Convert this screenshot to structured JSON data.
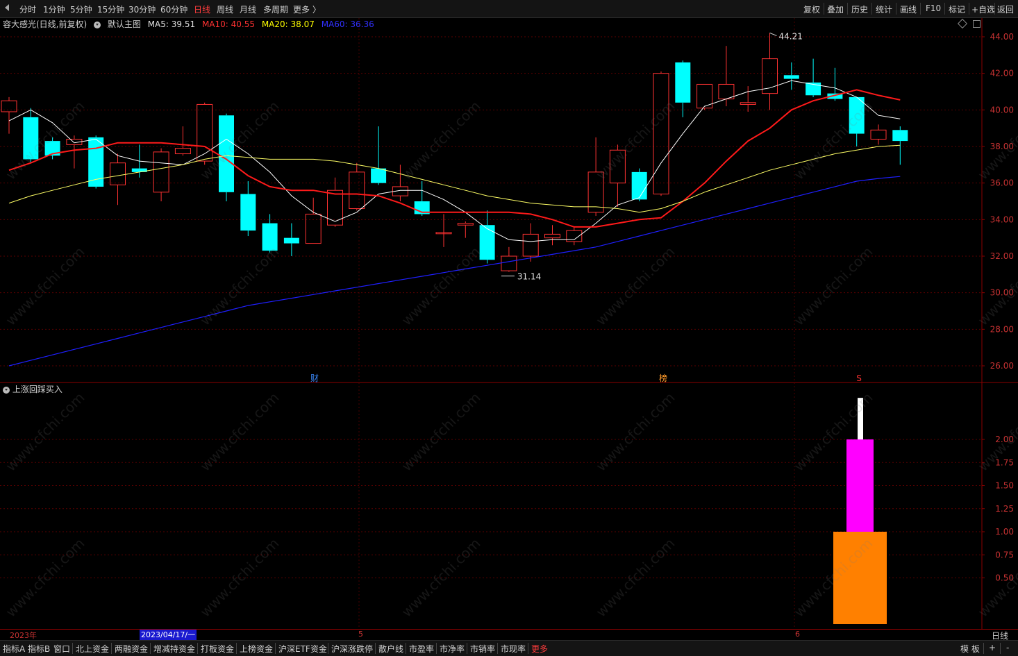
{
  "toolbar": {
    "periods": [
      "分时",
      "1分钟",
      "5分钟",
      "15分钟",
      "30分钟",
      "60分钟",
      "日线",
      "周线",
      "月线",
      "多周期",
      "更多 〉"
    ],
    "active_period": "日线",
    "right_items": [
      "复权",
      "叠加",
      "历史",
      "统计",
      "画线",
      "F10",
      "标记",
      "+自选",
      "返回"
    ]
  },
  "main_legend": {
    "stock": "容大感光(日线,前复权)",
    "template": "默认主图",
    "ma5": "MA5: 39.51",
    "ma10": "MA10: 40.55",
    "ma20": "MA20: 38.07",
    "ma60": "MA60: 36.36"
  },
  "colors": {
    "up": "#ff3232",
    "down": "#00ffff",
    "ma5": "#ffffff",
    "ma10": "#ff1a1a",
    "ma20": "#ffff66",
    "ma60": "#1f1fff",
    "lower_magenta": "#ff00ff",
    "lower_orange": "#ff8000",
    "lower_white": "#ffffff"
  },
  "annotations": {
    "high_label": "44.21",
    "low_label": "31.14",
    "event_cai": "财",
    "event_bang": "榜",
    "event_s": "S"
  },
  "lower_title": "上涨回踩买入",
  "date_axis": {
    "year": "2023年",
    "cursor_date": "2023/04/17/一",
    "month5": "5",
    "month6": "6",
    "period": "日线"
  },
  "bottom_bar": {
    "items": [
      "指标A",
      "指标B",
      "窗口",
      "北上资金",
      "两融资金",
      "增减持资金",
      "打板资金",
      "上榜资金",
      "沪深ETF资金",
      "沪深涨跌停",
      "散户线",
      "市盈率",
      "市净率",
      "市销率",
      "市现率",
      "更多"
    ],
    "right_items": [
      "模 板",
      "+",
      "-"
    ]
  },
  "watermark": "www.cfchi.com",
  "chart_data": [
    {
      "type": "candlestick",
      "title": "容大感光(日线,前复权)",
      "y_axis_ticks": [
        "44.00",
        "42.00",
        "40.00",
        "38.00",
        "36.00",
        "34.00",
        "32.00",
        "30.00",
        "28.00",
        "26.00"
      ],
      "ylim": [
        25.0,
        45.0
      ],
      "candles": [
        {
          "o": 39.9,
          "c": 40.5,
          "h": 40.7,
          "l": 38.7
        },
        {
          "o": 39.6,
          "c": 37.3,
          "h": 40.1,
          "l": 37.1
        },
        {
          "o": 38.3,
          "c": 37.5,
          "h": 38.5,
          "l": 37.3
        },
        {
          "o": 38.1,
          "c": 38.4,
          "h": 38.6,
          "l": 36.8
        },
        {
          "o": 38.5,
          "c": 35.8,
          "h": 38.6,
          "l": 35.7
        },
        {
          "o": 35.9,
          "c": 37.1,
          "h": 37.6,
          "l": 34.8
        },
        {
          "o": 36.8,
          "c": 36.6,
          "h": 38.1,
          "l": 36.3
        },
        {
          "o": 35.5,
          "c": 37.7,
          "h": 37.9,
          "l": 35.0
        },
        {
          "o": 37.6,
          "c": 37.9,
          "h": 39.1,
          "l": 37.5
        },
        {
          "o": 37.2,
          "c": 40.3,
          "h": 40.4,
          "l": 37.0
        },
        {
          "o": 39.7,
          "c": 35.5,
          "h": 39.8,
          "l": 35.0
        },
        {
          "o": 35.4,
          "c": 33.4,
          "h": 36.1,
          "l": 33.1
        },
        {
          "o": 33.8,
          "c": 32.3,
          "h": 34.3,
          "l": 32.2
        },
        {
          "o": 33.0,
          "c": 32.7,
          "h": 33.8,
          "l": 32.0
        },
        {
          "o": 32.7,
          "c": 34.3,
          "h": 35.2,
          "l": 32.7
        },
        {
          "o": 33.7,
          "c": 35.6,
          "h": 36.3,
          "l": 33.6
        },
        {
          "o": 34.6,
          "c": 36.6,
          "h": 37.1,
          "l": 34.5
        },
        {
          "o": 36.8,
          "c": 36.0,
          "h": 39.1,
          "l": 35.9
        },
        {
          "o": 35.3,
          "c": 35.8,
          "h": 37.0,
          "l": 35.0
        },
        {
          "o": 35.0,
          "c": 34.3,
          "h": 36.1,
          "l": 34.2
        },
        {
          "o": 33.3,
          "c": 33.3,
          "h": 34.3,
          "l": 32.5
        },
        {
          "o": 33.7,
          "c": 33.8,
          "h": 33.9,
          "l": 33.0
        },
        {
          "o": 33.7,
          "c": 31.8,
          "h": 34.5,
          "l": 31.6
        },
        {
          "o": 31.2,
          "c": 32.0,
          "h": 32.5,
          "l": 31.14
        },
        {
          "o": 32.0,
          "c": 33.2,
          "h": 33.8,
          "l": 31.7
        },
        {
          "o": 33.0,
          "c": 33.2,
          "h": 33.7,
          "l": 32.6
        },
        {
          "o": 32.8,
          "c": 33.4,
          "h": 33.6,
          "l": 32.6
        },
        {
          "o": 34.4,
          "c": 36.6,
          "h": 38.5,
          "l": 34.2
        },
        {
          "o": 36.0,
          "c": 37.8,
          "h": 38.1,
          "l": 34.7
        },
        {
          "o": 36.6,
          "c": 35.1,
          "h": 36.8,
          "l": 35.0
        },
        {
          "o": 35.4,
          "c": 42.0,
          "h": 42.1,
          "l": 35.3
        },
        {
          "o": 42.6,
          "c": 40.4,
          "h": 42.7,
          "l": 39.6
        },
        {
          "o": 40.1,
          "c": 41.4,
          "h": 41.4,
          "l": 40.0
        },
        {
          "o": 40.6,
          "c": 41.4,
          "h": 43.5,
          "l": 40.2
        },
        {
          "o": 40.3,
          "c": 40.4,
          "h": 41.3,
          "l": 39.9
        },
        {
          "o": 40.9,
          "c": 42.8,
          "h": 44.21,
          "l": 40.0
        },
        {
          "o": 41.9,
          "c": 41.7,
          "h": 42.6,
          "l": 41.1
        },
        {
          "o": 41.5,
          "c": 40.8,
          "h": 42.8,
          "l": 40.7
        },
        {
          "o": 40.9,
          "c": 40.6,
          "h": 42.3,
          "l": 40.5
        },
        {
          "o": 40.7,
          "c": 38.7,
          "h": 40.7,
          "l": 38.0
        },
        {
          "o": 38.4,
          "c": 38.9,
          "h": 39.2,
          "l": 38.1
        },
        {
          "o": 38.9,
          "c": 38.3,
          "h": 39.1,
          "l": 37.0
        }
      ],
      "series": [
        {
          "name": "MA5",
          "values": [
            39.4,
            40.0,
            39.3,
            38.2,
            38.4,
            37.5,
            37.2,
            37.1,
            37.0,
            37.6,
            38.4,
            37.6,
            36.6,
            35.3,
            34.4,
            33.9,
            34.4,
            35.4,
            35.6,
            35.6,
            35.1,
            34.4,
            33.5,
            32.9,
            32.8,
            32.9,
            32.9,
            33.8,
            34.8,
            35.2,
            37.1,
            38.7,
            40.2,
            40.6,
            41.0,
            41.2,
            41.6,
            41.4,
            41.2,
            40.7,
            39.7,
            39.51
          ]
        },
        {
          "name": "MA10",
          "values": [
            36.7,
            37.1,
            37.6,
            37.8,
            37.9,
            38.2,
            38.2,
            38.2,
            38.1,
            38.0,
            37.3,
            36.4,
            35.8,
            35.6,
            35.6,
            35.4,
            35.4,
            35.3,
            34.9,
            34.4,
            34.4,
            34.4,
            34.4,
            34.4,
            34.3,
            34.0,
            33.6,
            33.6,
            33.8,
            34.0,
            34.1,
            35.0,
            36.0,
            37.2,
            38.3,
            39.0,
            40.0,
            40.5,
            40.8,
            41.1,
            40.8,
            40.55
          ]
        },
        {
          "name": "MA20",
          "values": [
            34.9,
            35.3,
            35.6,
            35.9,
            36.2,
            36.4,
            36.6,
            36.8,
            37.0,
            37.3,
            37.5,
            37.4,
            37.3,
            37.3,
            37.3,
            37.2,
            37.0,
            36.8,
            36.5,
            36.2,
            35.9,
            35.6,
            35.3,
            35.1,
            34.9,
            34.8,
            34.7,
            34.7,
            34.6,
            34.4,
            34.6,
            35.0,
            35.5,
            35.9,
            36.3,
            36.7,
            37.0,
            37.3,
            37.6,
            37.8,
            38.0,
            38.07
          ]
        },
        {
          "name": "MA60",
          "values": [
            26.0,
            26.3,
            26.6,
            26.9,
            27.2,
            27.5,
            27.8,
            28.1,
            28.4,
            28.7,
            29.0,
            29.3,
            29.5,
            29.7,
            29.9,
            30.1,
            30.3,
            30.5,
            30.7,
            30.9,
            31.1,
            31.3,
            31.5,
            31.7,
            31.9,
            32.1,
            32.3,
            32.5,
            32.8,
            33.1,
            33.4,
            33.7,
            34.0,
            34.3,
            34.6,
            34.9,
            35.2,
            35.5,
            35.8,
            36.1,
            36.25,
            36.36
          ]
        }
      ]
    },
    {
      "type": "bar",
      "title": "上涨回踩买入",
      "y_axis_ticks": [
        "2.00",
        "1.75",
        "1.50",
        "1.25",
        "1.00",
        "0.75",
        "0.50"
      ],
      "ylim": [
        0.0,
        2.5
      ],
      "bars": [
        {
          "name": "orange",
          "value": 1.0,
          "start": 0.0
        },
        {
          "name": "magenta",
          "value": 2.0,
          "start": 1.0
        },
        {
          "name": "white",
          "value": 2.45,
          "start": 2.0
        }
      ]
    }
  ]
}
